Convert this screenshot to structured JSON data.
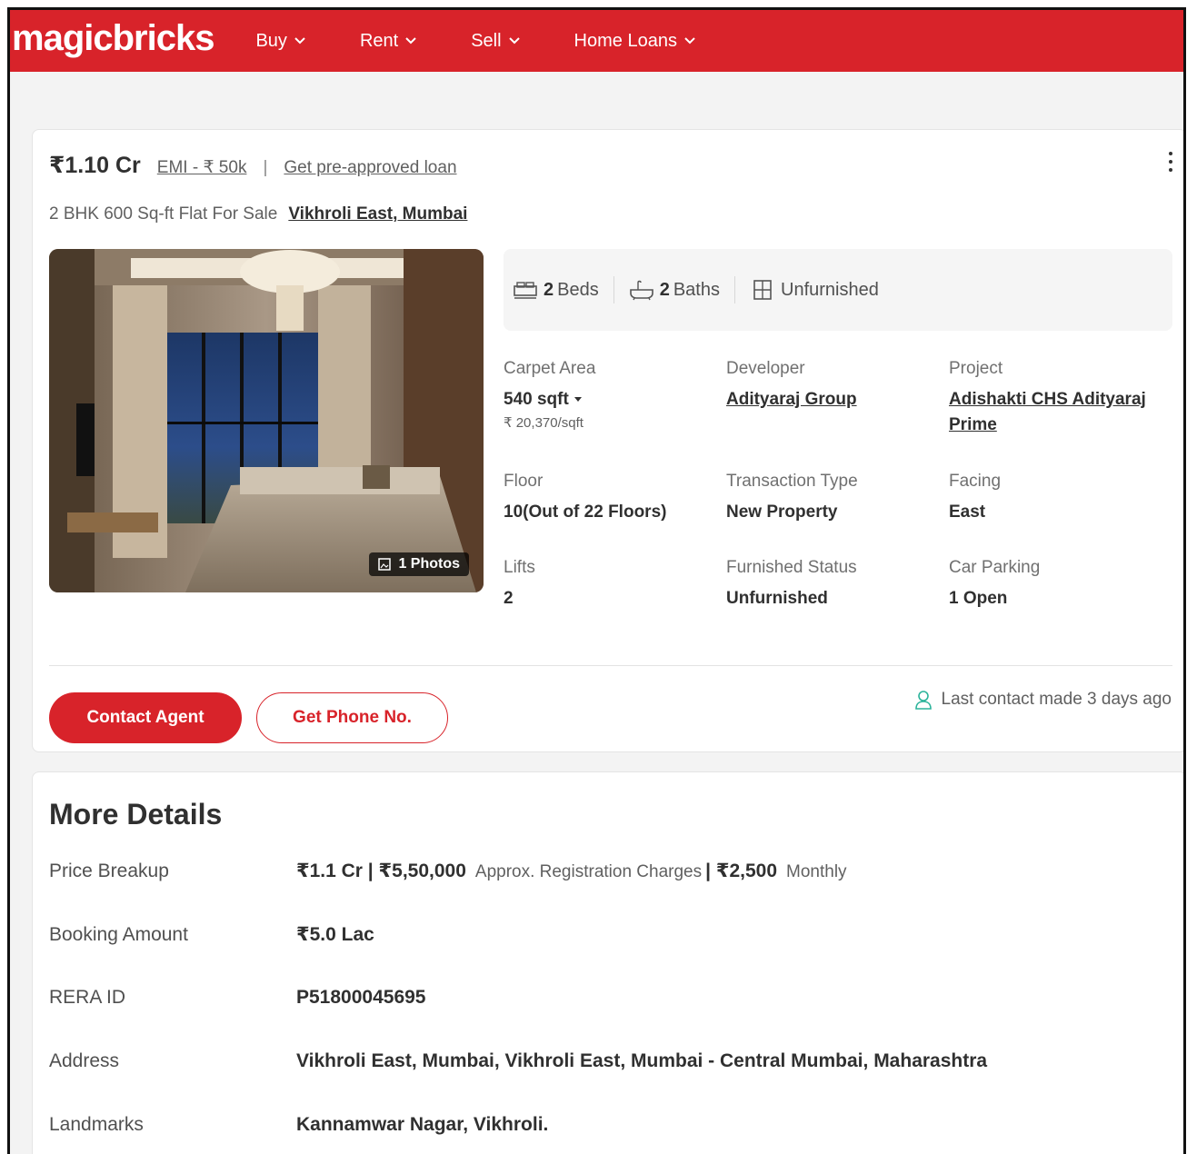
{
  "header": {
    "logo": "magicbricks",
    "nav": [
      {
        "label": "Buy"
      },
      {
        "label": "Rent"
      },
      {
        "label": "Sell"
      },
      {
        "label": "Home Loans"
      }
    ]
  },
  "listing": {
    "price": "₹1.10 Cr",
    "emi": "EMI - ₹ 50k",
    "separator": "|",
    "preapproved": "Get pre-approved loan",
    "title": "2 BHK 600 Sq-ft Flat For Sale",
    "location": "Vikhroli East, Mumbai",
    "photos_label": "1 Photos",
    "summary": {
      "beds_num": "2",
      "beds_label": "Beds",
      "baths_num": "2",
      "baths_label": "Baths",
      "furnishing": "Unfurnished"
    },
    "details": {
      "carpet_area_label": "Carpet Area",
      "carpet_area_value": "540 sqft",
      "carpet_area_rate": "₹ 20,370/sqft",
      "developer_label": "Developer",
      "developer_value": "Adityaraj Group",
      "project_label": "Project",
      "project_value": "Adishakti CHS Adityaraj Prime",
      "floor_label": "Floor",
      "floor_value": "10(Out of 22 Floors)",
      "transaction_label": "Transaction Type",
      "transaction_value": "New Property",
      "facing_label": "Facing",
      "facing_value": "East",
      "lifts_label": "Lifts",
      "lifts_value": "2",
      "furnished_label": "Furnished Status",
      "furnished_value": "Unfurnished",
      "parking_label": "Car Parking",
      "parking_value": "1 Open"
    },
    "contact_agent": "Contact Agent",
    "get_phone": "Get Phone No.",
    "last_contact": "Last contact made 3 days ago"
  },
  "more_details": {
    "title": "More Details",
    "price_breakup_label": "Price Breakup",
    "price_breakup_v1": "₹1.1 Cr | ₹5,50,000",
    "price_breakup_t1": "Approx. Registration Charges",
    "price_breakup_v2": "| ₹2,500",
    "price_breakup_t2": "Monthly",
    "booking_label": "Booking Amount",
    "booking_value": "₹5.0 Lac",
    "rera_label": "RERA ID",
    "rera_value": "P51800045695",
    "address_label": "Address",
    "address_value": "Vikhroli East, Mumbai, Vikhroli East, Mumbai - Central Mumbai, Maharashtra",
    "landmarks_label": "Landmarks",
    "landmarks_value": "Kannamwar Nagar, Vikhroli."
  },
  "colors": {
    "brand": "#d8232a",
    "text": "#303030",
    "muted": "#606060",
    "contact_icon": "#2bb39a"
  }
}
